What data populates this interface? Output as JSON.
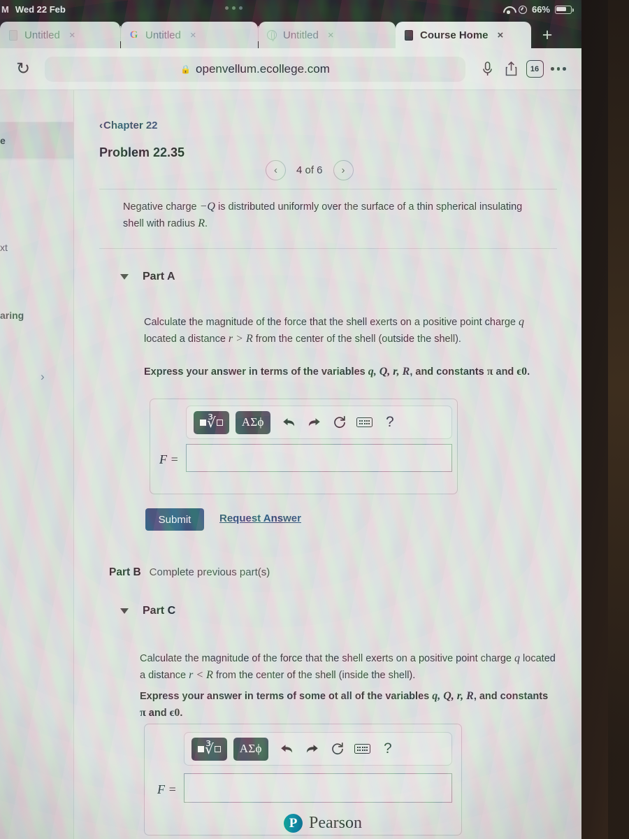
{
  "status_bar": {
    "time_partial": "M",
    "date": "Wed 22 Feb",
    "battery_percent": "66%",
    "wifi_icon": "wifi-icon",
    "location_icon": "location-icon",
    "battery_icon": "battery-icon"
  },
  "browser": {
    "tabs": [
      {
        "label": "Untitled",
        "favicon": "document-icon",
        "close": "×",
        "active": false
      },
      {
        "label": "Untitled",
        "favicon": "google-g-icon",
        "close": "×",
        "active": false
      },
      {
        "label": "Untitled",
        "favicon": "globe-icon",
        "close": "×",
        "active": false
      },
      {
        "label": "Course Home",
        "favicon": "book-icon",
        "close": "×",
        "active": true
      }
    ],
    "new_tab_label": "+",
    "reload_icon": "↻",
    "url": "openvellum.ecollege.com",
    "lock_icon": "🔒",
    "microphone_icon": "microphone-icon",
    "share_icon": "share-icon",
    "tab_count": "16",
    "more_icon": "more-dots-icon"
  },
  "sidebar": {
    "items": [
      {
        "label": "e",
        "selected": true
      },
      {
        "label": "xt",
        "selected": false
      },
      {
        "label": "aring",
        "selected": false
      },
      {
        "label": "",
        "selected": false
      }
    ],
    "chevron": "›"
  },
  "problem": {
    "chapter_link": "Chapter 22",
    "chapter_back_chevron": "‹",
    "title": "Problem 22.35",
    "pager": {
      "prev": "‹",
      "label": "4 of 6",
      "next": "›"
    },
    "statement_pre": "Negative charge ",
    "statement_q": "−Q",
    "statement_mid": " is distributed uniformly over the surface of a thin spherical insulating shell with radius ",
    "statement_r": "R",
    "statement_end": "."
  },
  "part_a": {
    "title": "Part A",
    "toggle_icon": "triangle-down-icon",
    "question_1": "Calculate the magnitude of the force that the shell exerts on a positive point charge ",
    "question_q": "q",
    "question_2": " located a distance ",
    "question_rgtR": "r > R",
    "question_3": " from the center of the shell (outside the shell).",
    "instruction_1": "Express your answer in terms of the variables ",
    "instruction_vars": "q, Q, r, R",
    "instruction_2": ", and constants ",
    "instruction_pi": "π",
    "instruction_3": " and ",
    "instruction_eps": "ϵ0",
    "instruction_4": ".",
    "answer_label": "F =",
    "answer_value": "",
    "submit_label": "Submit",
    "request_answer_label": "Request Answer"
  },
  "math_toolbar": {
    "template_button": "template-button",
    "greek_button": "ΑΣϕ",
    "undo_icon": "undo-arrow-icon",
    "redo_icon": "redo-arrow-icon",
    "reset_icon": "reset-circle-icon",
    "keyboard_icon": "keyboard-icon",
    "help_icon": "?"
  },
  "part_b": {
    "label": "Part B",
    "status": "Complete previous part(s)"
  },
  "part_c": {
    "title": "Part C",
    "toggle_icon": "triangle-down-icon",
    "question_1": "Calculate the magnitude of the force that the shell exerts on a positive point charge ",
    "question_q": "q",
    "question_2": " located a distance ",
    "question_rltR": "r < R",
    "question_3": " from the center of the shell (inside the shell).",
    "instruction_1": "Express your answer in terms of some ot all of the variables ",
    "instruction_vars": "q, Q, r, R",
    "instruction_2": ", and constants ",
    "instruction_pi": "π",
    "instruction_3": " and ",
    "instruction_eps": "ϵ0",
    "instruction_4": ".",
    "answer_label": "F =",
    "answer_value": ""
  },
  "footer": {
    "brand_mark": "P",
    "brand_name": "Pearson"
  },
  "colors": {
    "submit_bg": "#2e4d64",
    "link": "#26405c",
    "math_button_bg": "#3c4244",
    "pearson_teal": "#0a6b7c"
  }
}
